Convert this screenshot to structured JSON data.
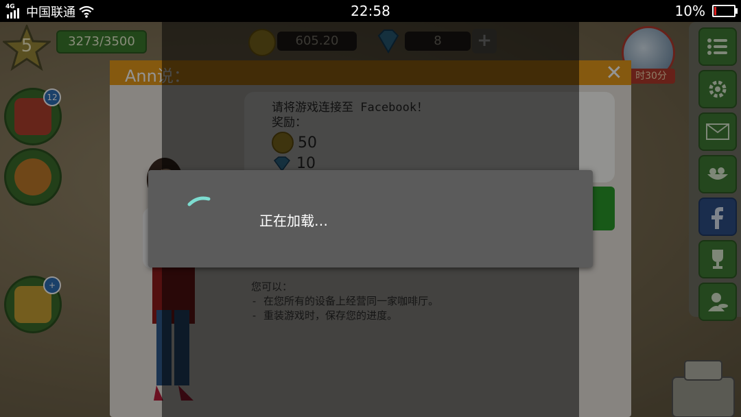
{
  "status_bar": {
    "network_type": "4G",
    "carrier": "中国联通",
    "time": "22:58",
    "battery_percent": "10%"
  },
  "game": {
    "level": "5",
    "xp": "3273/3500",
    "coins": "605.20",
    "gems": "8",
    "gem_add": "+",
    "event_timer": "时30分",
    "recipe_badge": "12",
    "gift_badge": "+",
    "colors": {
      "accent_orange": "#e59a1a",
      "rail_green": "#3f7a34",
      "loader_bg": "#5b5b5b",
      "spinner": "#7ddcd0"
    }
  },
  "dialog": {
    "title": "Ann说：",
    "close": "✕",
    "speech": {
      "line1": "请将游戏连接至 Facebook！",
      "line2": "奖励：",
      "coin_reward": "50",
      "gem_reward": "10"
    },
    "perks": {
      "heading": "您可以：",
      "item1": "- 在您所有的设备上经营同一家咖啡厅。",
      "item2": "- 重装游戏时，保存您的进度。"
    }
  },
  "loading": {
    "text": "正在加载…"
  },
  "right_rail": {
    "icons": [
      "list-icon",
      "gear-icon",
      "mail-icon",
      "food-icon",
      "facebook-icon",
      "trophy-icon",
      "chef-icon"
    ]
  }
}
